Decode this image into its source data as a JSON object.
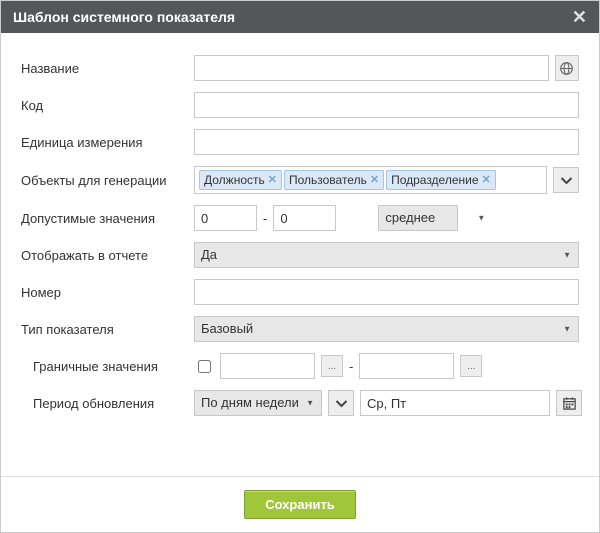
{
  "dialog": {
    "title": "Шаблон системного показателя"
  },
  "labels": {
    "name": "Название",
    "code": "Код",
    "unit": "Единица измерения",
    "genObjects": "Объекты для генерации",
    "allowed": "Допустимые значения",
    "showReport": "Отображать в отчете",
    "number": "Номер",
    "indicatorType": "Тип показателя",
    "boundary": "Граничные значения",
    "updatePeriod": "Период обновления"
  },
  "fields": {
    "name": "",
    "code": "",
    "unit": "",
    "tags": [
      "Должность",
      "Пользователь",
      "Подразделение"
    ],
    "allowedMin": "0",
    "allowedMax": "0",
    "aggOptions": [
      "среднее"
    ],
    "aggSelected": "среднее",
    "showReportOptions": [
      "Да"
    ],
    "showReportSelected": "Да",
    "number": "",
    "indicatorTypeOptions": [
      "Базовый"
    ],
    "indicatorTypeSelected": "Базовый",
    "boundaryLow": "",
    "boundaryHigh": "",
    "periodModeOptions": [
      "По дням недели"
    ],
    "periodModeSelected": "По дням недели",
    "periodDays": "Ср, Пт"
  },
  "buttons": {
    "save": "Сохранить"
  },
  "icons": {
    "dashSep": "-"
  }
}
